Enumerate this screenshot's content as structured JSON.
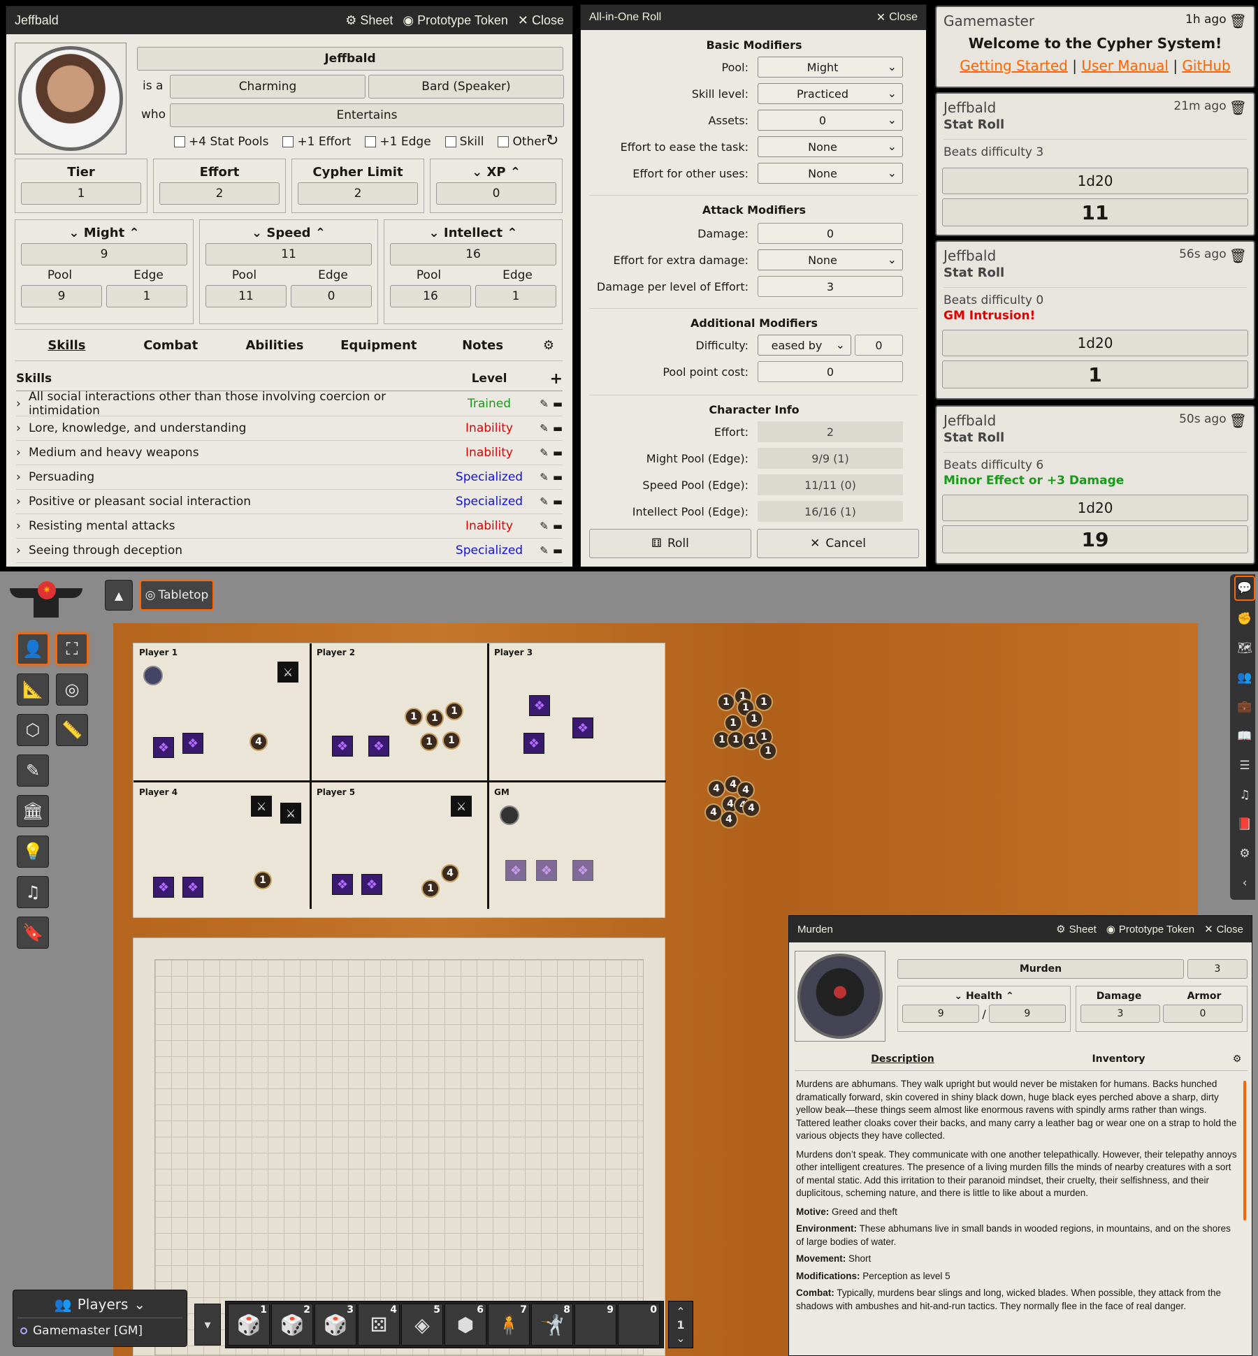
{
  "sheet": {
    "title": "Jeffbald",
    "actions": [
      "Sheet",
      "Prototype Token",
      "Close"
    ],
    "name": "Jeffbald",
    "is_a": "is a",
    "who": "who",
    "descriptor": "Charming",
    "type": "Bard (Speaker)",
    "focus": "Entertains",
    "checks": [
      "+4 Stat Pools",
      "+1 Effort",
      "+1 Edge",
      "Skill",
      "Other"
    ],
    "tier_label": "Tier",
    "tier": "1",
    "effort_label": "Effort",
    "effort": "2",
    "cypher_label": "Cypher Limit",
    "cypher": "2",
    "xp_label": "XP",
    "xp": "0",
    "pools": [
      {
        "name": "Might",
        "value": "9",
        "pool": "9",
        "edge": "1"
      },
      {
        "name": "Speed",
        "value": "11",
        "pool": "11",
        "edge": "0"
      },
      {
        "name": "Intellect",
        "value": "16",
        "pool": "16",
        "edge": "1"
      }
    ],
    "pool_label": "Pool",
    "edge_label": "Edge",
    "tabs": [
      "Skills",
      "Combat",
      "Abilities",
      "Equipment",
      "Notes"
    ],
    "skills_header": "Skills",
    "level_header": "Level",
    "skills": [
      {
        "name": "All social interactions other than those involving coercion or intimidation",
        "level": "Trained"
      },
      {
        "name": "Lore, knowledge, and understanding",
        "level": "Inability"
      },
      {
        "name": "Medium and heavy weapons",
        "level": "Inability"
      },
      {
        "name": "Persuading",
        "level": "Specialized"
      },
      {
        "name": "Positive or pleasant social interaction",
        "level": "Specialized"
      },
      {
        "name": "Resisting mental attacks",
        "level": "Inability"
      },
      {
        "name": "Seeing through deception",
        "level": "Specialized"
      }
    ],
    "level_colors": {
      "Trained": "#1a9a1a",
      "Inability": "#e00000",
      "Specialized": "#1010e0"
    }
  },
  "roll": {
    "title": "All-in-One Roll",
    "close": "Close",
    "basic": "Basic Modifiers",
    "pool_l": "Pool:",
    "pool": "Might",
    "skill_l": "Skill level:",
    "skill": "Practiced",
    "assets_l": "Assets:",
    "assets": "0",
    "ease_l": "Effort to ease the task:",
    "ease": "None",
    "other_l": "Effort for other uses:",
    "other": "None",
    "attack": "Attack Modifiers",
    "damage_l": "Damage:",
    "damage": "0",
    "extra_l": "Effort for extra damage:",
    "extra": "None",
    "dpl_l": "Damage per level of Effort:",
    "dpl": "3",
    "add": "Additional Modifiers",
    "diff_l": "Difficulty:",
    "diff_mode": "eased by",
    "diff": "0",
    "cost_l": "Pool point cost:",
    "cost": "0",
    "char": "Character Info",
    "ceffort_l": "Effort:",
    "ceffort": "2",
    "might_l": "Might Pool (Edge):",
    "might": "9/9 (1)",
    "speed_l": "Speed Pool (Edge):",
    "speed": "11/11 (0)",
    "int_l": "Intellect Pool (Edge):",
    "int": "16/16 (1)",
    "roll_btn": "Roll",
    "cancel_btn": "Cancel"
  },
  "chat": [
    {
      "who": "Gamemaster",
      "time": "1h ago",
      "welcome": "Welcome to the Cypher System!",
      "links": [
        "Getting Started",
        "User Manual",
        "GitHub"
      ]
    },
    {
      "who": "Jeffbald",
      "time": "21m ago",
      "kind": "Stat Roll",
      "diff": "Beats difficulty 3",
      "effect": "",
      "formula": "1d20",
      "total": "11"
    },
    {
      "who": "Jeffbald",
      "time": "56s ago",
      "kind": "Stat Roll",
      "diff": "Beats difficulty 0",
      "effect": "GM Intrusion!",
      "effect_color": "#e00000",
      "formula": "1d20",
      "total": "1"
    },
    {
      "who": "Jeffbald",
      "time": "50s ago",
      "kind": "Stat Roll",
      "diff": "Beats difficulty 6",
      "effect": "Minor Effect or +3 Damage",
      "effect_color": "#1a9a1a",
      "formula": "1d20",
      "total": "19"
    }
  ],
  "scene": {
    "tab": "Tabletop",
    "areas": [
      "Player 1",
      "Player 2",
      "Player 3",
      "Player 4",
      "Player 5",
      "GM"
    ]
  },
  "players": {
    "title": "Players",
    "gm": "Gamemaster [GM]"
  },
  "hotbar": {
    "keys": [
      "1",
      "2",
      "3",
      "4",
      "5",
      "6",
      "7",
      "8",
      "9",
      "0"
    ],
    "page": "1"
  },
  "murden": {
    "title": "Murden",
    "actions": [
      "Sheet",
      "Prototype Token",
      "Close"
    ],
    "name": "Murden",
    "level": "3",
    "health_l": "Health",
    "health": "9",
    "health_max": "9",
    "damage_l": "Damage",
    "damage": "3",
    "armor_l": "Armor",
    "armor": "0",
    "tabs": [
      "Description",
      "Inventory"
    ],
    "p1": "Murdens are abhumans. They walk upright but would never be mistaken for humans. Backs hunched dramatically forward, skin covered in shiny black down, huge black eyes perched above a sharp, dirty yellow beak—these things seem almost like enormous ravens with spindly arms rather than wings. Tattered leather cloaks cover their backs, and many carry a leather bag or wear one on a strap to hold the various objects they have collected.",
    "p2": "Murdens don’t speak. They communicate with one another telepathically. However, their telepathy annoys other intelligent creatures. The presence of a living murden fills the minds of nearby creatures with a sort of mental static. Add this irritation to their paranoid mindset, their cruelty, their selfishness, and their duplicitous, scheming nature, and there is little to like about a murden.",
    "motive_l": "Motive:",
    "motive": "Greed and theft",
    "env_l": "Environment:",
    "env": "These abhumans live in small bands in wooded regions, in mountains, and on the shores of large bodies of water.",
    "move_l": "Movement:",
    "move": "Short",
    "mod_l": "Modifications:",
    "mod": "Perception as level 5",
    "combat_l": "Combat:",
    "combat": "Typically, murdens bear slings and long, wicked blades. When possible, they attack from the shadows with ambushes and hit-and-run tactics. They normally flee in the face of real danger."
  }
}
